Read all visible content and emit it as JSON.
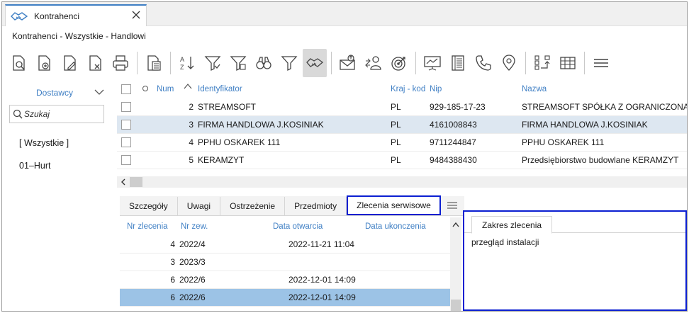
{
  "tab": {
    "title": "Kontrahenci"
  },
  "breadcrumb": "Kontrahenci - Wszystkie - Handlowi",
  "toolbar": {
    "icons": [
      "preview-icon",
      "add-doc-icon",
      "edit-doc-icon",
      "delete-doc-icon",
      "print-icon",
      "calculator-doc-icon",
      "sort-az-icon",
      "filter-icon",
      "filter-clear-icon",
      "binoculars-icon",
      "funnel-icon",
      "handshake-icon",
      "mail-icon",
      "people-icon",
      "target-icon",
      "presentation-icon",
      "ledger-icon",
      "phone-icon",
      "map-pin-icon",
      "transfer-icon",
      "table-icon",
      "menu-icon"
    ]
  },
  "left": {
    "group_label": "Dostawcy",
    "search_placeholder": "Szukaj",
    "categories": [
      "[ Wszystkie ]",
      "01–Hurt"
    ]
  },
  "grid": {
    "headers": {
      "num": "Num",
      "ident": "Identyfikator",
      "kraj": "Kraj - kod",
      "nip": "Nip",
      "nazwa": "Nazwa"
    },
    "rows": [
      {
        "num": "2",
        "ident": "STREAMSOFT",
        "kraj": "PL",
        "nip": "929-185-17-23",
        "nazwa": "STREAMSOFT SPÓŁKA Z OGRANICZONĄ"
      },
      {
        "num": "3",
        "ident": "FIRMA HANDLOWA J.KOSINIAK",
        "kraj": "PL",
        "nip": "4161008843",
        "nazwa": "FIRMA HANDLOWA J.KOSINIAK"
      },
      {
        "num": "4",
        "ident": "PPHU OSKAREK 111",
        "kraj": "PL",
        "nip": "9711244847",
        "nazwa": "PPHU OSKAREK 111"
      },
      {
        "num": "5",
        "ident": "KERAMZYT",
        "kraj": "PL",
        "nip": "9484388430",
        "nazwa": "Przedsiębiorstwo budowlane KERAMZYT"
      }
    ]
  },
  "subtabs": [
    "Szczegóły",
    "Uwagi",
    "Ostrzeżenie",
    "Przedmioty",
    "Zlecenia serwisowe"
  ],
  "orders": {
    "headers": {
      "nr": "Nr zlecenia",
      "nrzew": "Nr zew.",
      "otw": "Data otwarcia",
      "ukon": "Data ukonczenia"
    },
    "rows": [
      {
        "nr": "4",
        "nrzew": "2022/4",
        "otw": "2022-11-21 11:04"
      },
      {
        "nr": "3",
        "nrzew": "2023/3",
        "otw": ""
      },
      {
        "nr": "6",
        "nrzew": "2022/6",
        "otw": "2022-12-01 14:09"
      },
      {
        "nr": "6",
        "nrzew": "2022/6",
        "otw": "2022-12-01 14:09"
      }
    ]
  },
  "detail": {
    "tab": "Zakres zlecenia",
    "text": "przegląd instalacji"
  },
  "colors": {
    "accent": "#3f7fc4",
    "highlight_border": "#0b1fd1",
    "selected_row": "#9cc3e6"
  }
}
